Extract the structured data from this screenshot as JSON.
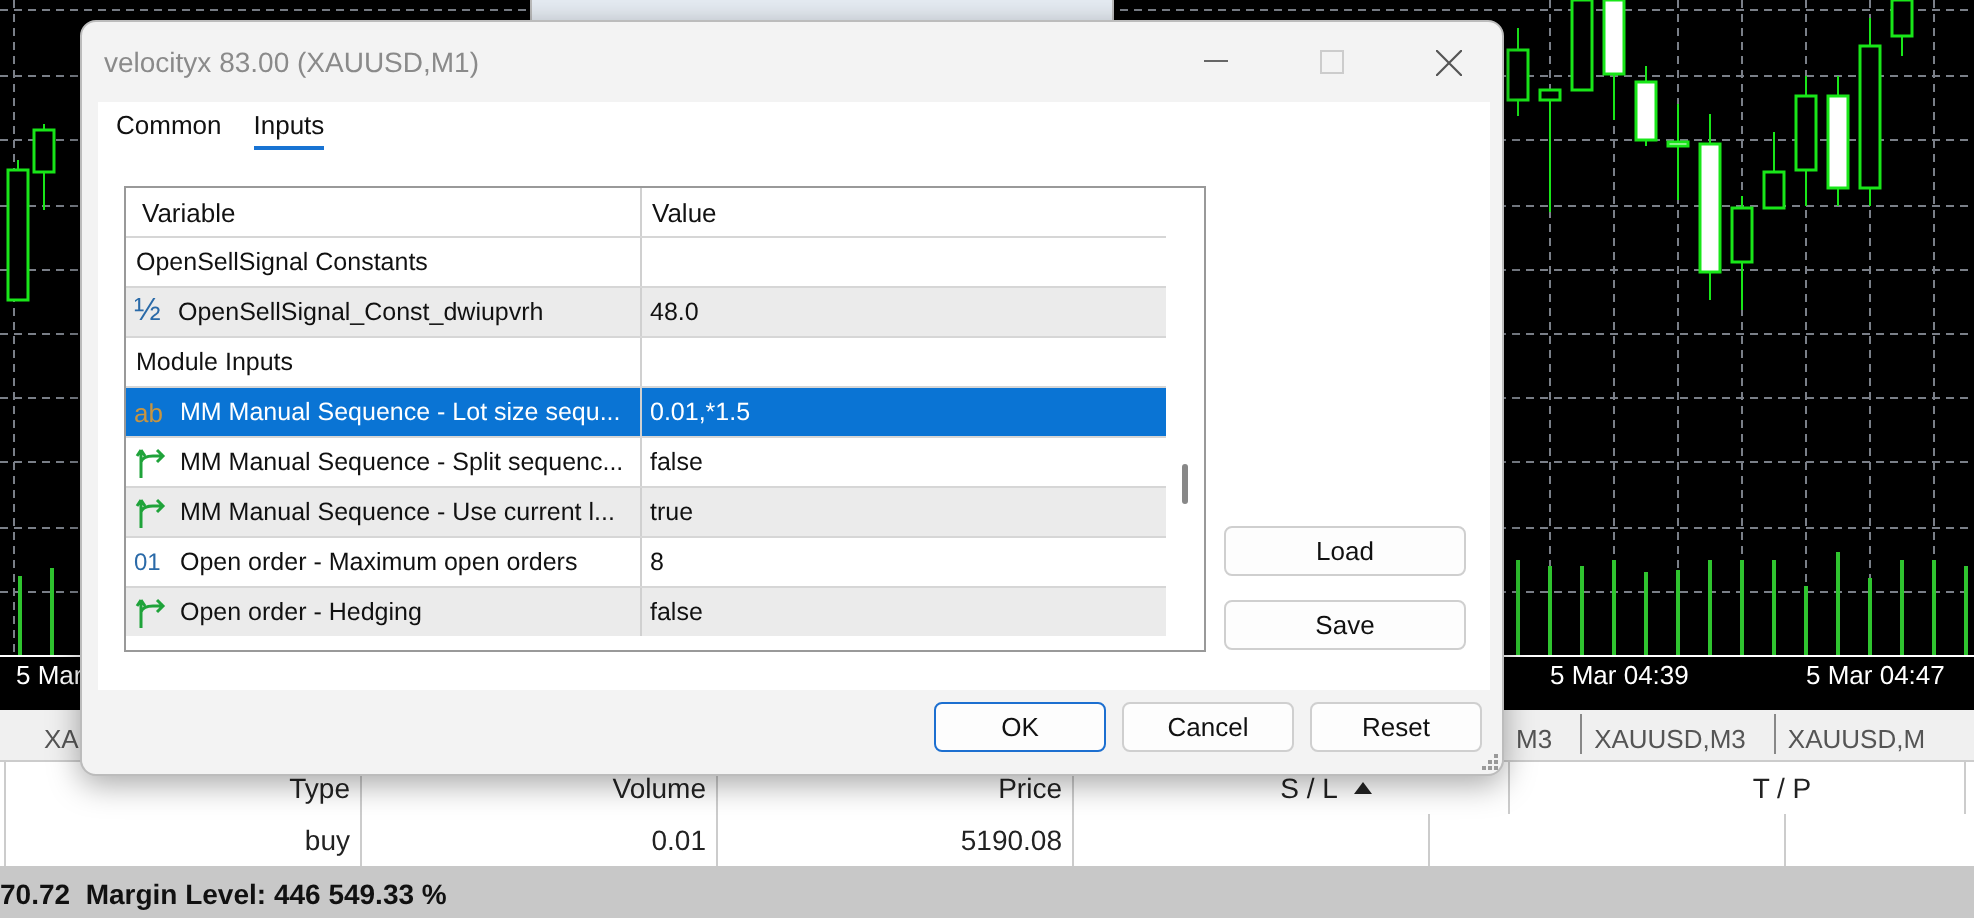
{
  "window": {
    "title": "velocityx 83.00 (XAUUSD,M1)"
  },
  "tabs": [
    {
      "label": "Common",
      "selected": false
    },
    {
      "label": "Inputs",
      "selected": true
    }
  ],
  "grid": {
    "columns": [
      "Variable",
      "Value"
    ],
    "rows": [
      {
        "kind": "group",
        "variable": "OpenSellSignal Constants",
        "selected": false
      },
      {
        "kind": "double",
        "icon": "½",
        "variable": "OpenSellSignal_Const_dwiupvrh",
        "value": "48.0",
        "selected": false
      },
      {
        "kind": "group",
        "variable": "Module Inputs",
        "selected": false
      },
      {
        "kind": "string",
        "icon": "ab",
        "variable": "MM Manual Sequence - Lot size sequ...",
        "value": "0.01,*1.5",
        "selected": true
      },
      {
        "kind": "bool",
        "variable": "MM Manual Sequence - Split sequenc...",
        "value": "false",
        "selected": false
      },
      {
        "kind": "bool",
        "variable": "MM Manual Sequence - Use current l...",
        "value": "true",
        "selected": false
      },
      {
        "kind": "int",
        "icon": "01",
        "variable": "Open order - Maximum open orders",
        "value": "8",
        "selected": false
      },
      {
        "kind": "bool",
        "variable": "Open order - Hedging",
        "value": "false",
        "selected": false
      }
    ]
  },
  "side_buttons": [
    "Load",
    "Save"
  ],
  "buttons": [
    {
      "label": "OK",
      "default": true
    },
    {
      "label": "Cancel",
      "default": false
    },
    {
      "label": "Reset",
      "default": false
    }
  ],
  "background": {
    "chart_time_labels": [
      "5 Mar",
      "5 Mar 04:39",
      "5 Mar 04:47"
    ],
    "chart_tabs": [
      "XA",
      "M3",
      "XAUUSD,M3",
      "XAUUSD,M"
    ],
    "trade_table": {
      "columns": [
        {
          "label": "Type"
        },
        {
          "label": "Volume"
        },
        {
          "label": "Price"
        },
        {
          "label": "S / L",
          "sorted": true
        },
        {
          "label": "T / P"
        }
      ],
      "rows": [
        [
          "buy",
          "0.01",
          "5190.08"
        ]
      ]
    },
    "status_bar": "70.72  Margin Level: 446 549.33 %"
  }
}
